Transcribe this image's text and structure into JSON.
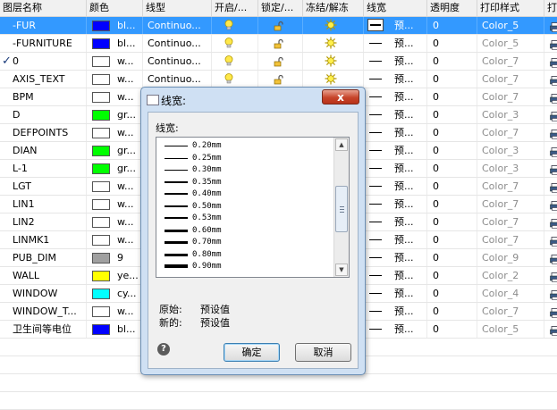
{
  "columns": [
    "图层名称",
    "颜色",
    "线型",
    "开启/...",
    "锁定/...",
    "冻结/解冻",
    "线宽",
    "透明度",
    "打印样式",
    "打"
  ],
  "rows": [
    {
      "name": "-FUR",
      "color_hex": "#0000ff",
      "color_text": "bl...",
      "linetype": "Continuo...",
      "lw": "预...",
      "trans": "0",
      "style": "Color_5",
      "selected": true,
      "show_ltype": true,
      "icons": true
    },
    {
      "name": "-FURNITURE",
      "color_hex": "#0000ff",
      "color_text": "bl...",
      "linetype": "Continuo...",
      "lw": "预...",
      "trans": "0",
      "style": "Color_5",
      "show_ltype": true,
      "icons": true
    },
    {
      "name": "0",
      "color_hex": "#ffffff",
      "color_text": "w...",
      "linetype": "Continuo...",
      "lw": "预...",
      "trans": "0",
      "style": "Color_7",
      "current": true,
      "show_ltype": true,
      "icons": true
    },
    {
      "name": "AXIS_TEXT",
      "color_hex": "#ffffff",
      "color_text": "w...",
      "linetype": "Continuo...",
      "lw": "预...",
      "trans": "0",
      "style": "Color_7",
      "show_ltype": true,
      "icons": true
    },
    {
      "name": "BPM",
      "color_hex": "#ffffff",
      "color_text": "w...",
      "lw": "预...",
      "trans": "0",
      "style": "Color_7"
    },
    {
      "name": "D",
      "color_hex": "#00ff00",
      "color_text": "gr...",
      "lw": "预...",
      "trans": "0",
      "style": "Color_3"
    },
    {
      "name": "DEFPOINTS",
      "color_hex": "#ffffff",
      "color_text": "w...",
      "lw": "预...",
      "trans": "0",
      "style": "Color_7"
    },
    {
      "name": "DIAN",
      "color_hex": "#00ff00",
      "color_text": "gr...",
      "lw": "预...",
      "trans": "0",
      "style": "Color_3"
    },
    {
      "name": "L-1",
      "color_hex": "#00ff00",
      "color_text": "gr...",
      "lw": "预...",
      "trans": "0",
      "style": "Color_3"
    },
    {
      "name": "LGT",
      "color_hex": "#ffffff",
      "color_text": "w...",
      "lw": "预...",
      "trans": "0",
      "style": "Color_7"
    },
    {
      "name": "LIN1",
      "color_hex": "#ffffff",
      "color_text": "w...",
      "lw": "预...",
      "trans": "0",
      "style": "Color_7"
    },
    {
      "name": "LIN2",
      "color_hex": "#ffffff",
      "color_text": "w...",
      "lw": "预...",
      "trans": "0",
      "style": "Color_7"
    },
    {
      "name": "LINMK1",
      "color_hex": "#ffffff",
      "color_text": "w...",
      "lw": "预...",
      "trans": "0",
      "style": "Color_7"
    },
    {
      "name": "PUB_DIM",
      "color_hex": "#a0a0a0",
      "color_text": "9",
      "lw": "预...",
      "trans": "0",
      "style": "Color_9"
    },
    {
      "name": "WALL",
      "color_hex": "#ffff00",
      "color_text": "ye...",
      "lw": "预...",
      "trans": "0",
      "style": "Color_2"
    },
    {
      "name": "WINDOW",
      "color_hex": "#00ffff",
      "color_text": "cy...",
      "lw": "预...",
      "trans": "0",
      "style": "Color_4"
    },
    {
      "name": "WINDOW_T...",
      "color_hex": "#ffffff",
      "color_text": "w...",
      "lw": "预...",
      "trans": "0",
      "style": "Color_7"
    },
    {
      "name": "卫生间等电位",
      "color_hex": "#0000ff",
      "color_text": "bl...",
      "lw": "预...",
      "trans": "0",
      "style": "Color_5"
    }
  ],
  "dialog": {
    "title": "线宽:",
    "close_glyph": "x",
    "list_label": "线宽:",
    "lineweights": [
      "0.20mm",
      "0.25mm",
      "0.30mm",
      "0.35mm",
      "0.40mm",
      "0.50mm",
      "0.53mm",
      "0.60mm",
      "0.70mm",
      "0.80mm",
      "0.90mm"
    ],
    "original_label": "原始:",
    "original_value": "预设值",
    "new_label": "新的:",
    "new_value": "预设值",
    "help_glyph": "?",
    "ok_label": "确定",
    "cancel_label": "取消"
  },
  "icons": {
    "current_layer": "checkmark-icon",
    "on": "lightbulb-icon",
    "lock": "padlock-icon",
    "freeze": "sun-icon",
    "print": "printer-icon"
  },
  "colors": {
    "selection": "#3399ff",
    "dialog_frame": "#cfe0f3",
    "close_button": "#c7442a"
  }
}
